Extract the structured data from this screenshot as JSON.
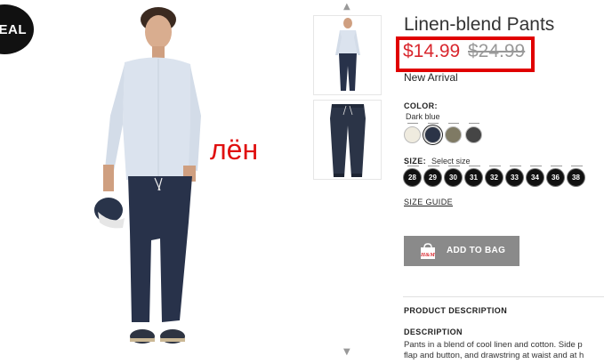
{
  "product": {
    "title": "Linen-blend Pants",
    "price_current": "$14.99",
    "price_original": "$24.99",
    "tag": "New Arrival"
  },
  "badge": {
    "label": "DEAL"
  },
  "annotation": {
    "word": "лён",
    "color": "#e01010"
  },
  "color_section": {
    "label": "COLOR:",
    "selected": "Dark blue",
    "swatches": [
      {
        "name": "beige",
        "hex": "#efebdf"
      },
      {
        "name": "dark-blue",
        "hex": "#2b3447"
      },
      {
        "name": "khaki",
        "hex": "#7f7a64"
      },
      {
        "name": "dark-gray",
        "hex": "#454545"
      }
    ]
  },
  "size_section": {
    "label": "SIZE:",
    "hint": "Select size",
    "sizes": [
      "28",
      "29",
      "30",
      "31",
      "32",
      "33",
      "34",
      "36",
      "38"
    ]
  },
  "size_guide": "SIZE GUIDE",
  "add_to_bag": {
    "label": "ADD TO BAG",
    "icon_text": "H&M"
  },
  "product_description": {
    "heading": "PRODUCT DESCRIPTION",
    "sub_heading": "DESCRIPTION",
    "lines": [
      "Pants in a blend of cool linen and cotton. Side p",
      "flap and button, and drawstring at waist and at h"
    ]
  },
  "thumb_nav": {
    "up": "▲",
    "down": "▼"
  },
  "colors": {
    "price_red": "#d9272e",
    "highlight_box": "#e00000",
    "button_gray": "#8a8a8a",
    "pants_navy": "#28324a"
  }
}
